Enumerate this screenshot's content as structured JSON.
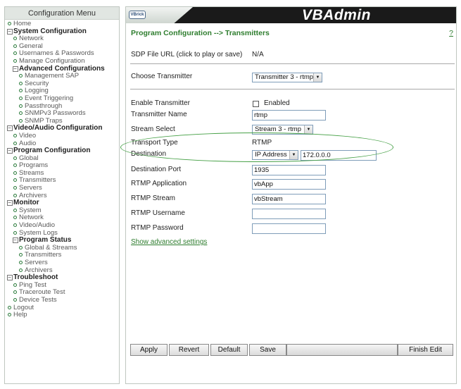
{
  "sidebar": {
    "title": "Configuration Menu",
    "items": [
      {
        "label": "Home",
        "level": 0,
        "marker": "dot"
      },
      {
        "label": "System Configuration",
        "level": 0,
        "marker": "box",
        "bold": true
      },
      {
        "label": "Network",
        "level": 1,
        "marker": "dot"
      },
      {
        "label": "General",
        "level": 1,
        "marker": "dot"
      },
      {
        "label": "Usernames & Passwords",
        "level": 1,
        "marker": "dot"
      },
      {
        "label": "Manage Configuration",
        "level": 1,
        "marker": "dot"
      },
      {
        "label": "Advanced Configurations",
        "level": 1,
        "marker": "box",
        "bold": true
      },
      {
        "label": "Management SAP",
        "level": 2,
        "marker": "dot"
      },
      {
        "label": "Security",
        "level": 2,
        "marker": "dot"
      },
      {
        "label": "Logging",
        "level": 2,
        "marker": "dot"
      },
      {
        "label": "Event Triggering",
        "level": 2,
        "marker": "dot"
      },
      {
        "label": "Passthrough",
        "level": 2,
        "marker": "dot"
      },
      {
        "label": "SNMPv3 Passwords",
        "level": 2,
        "marker": "dot"
      },
      {
        "label": "SNMP Traps",
        "level": 2,
        "marker": "dot"
      },
      {
        "label": "Video/Audio Configuration",
        "level": 0,
        "marker": "box",
        "bold": true
      },
      {
        "label": "Video",
        "level": 1,
        "marker": "dot"
      },
      {
        "label": "Audio",
        "level": 1,
        "marker": "dot"
      },
      {
        "label": "Program Configuration",
        "level": 0,
        "marker": "box",
        "bold": true
      },
      {
        "label": "Global",
        "level": 1,
        "marker": "dot"
      },
      {
        "label": "Programs",
        "level": 1,
        "marker": "dot"
      },
      {
        "label": "Streams",
        "level": 1,
        "marker": "dot"
      },
      {
        "label": "Transmitters",
        "level": 1,
        "marker": "dot"
      },
      {
        "label": "Servers",
        "level": 1,
        "marker": "dot"
      },
      {
        "label": "Archivers",
        "level": 1,
        "marker": "dot"
      },
      {
        "label": "Monitor",
        "level": 0,
        "marker": "box",
        "bold": true
      },
      {
        "label": "System",
        "level": 1,
        "marker": "dot"
      },
      {
        "label": "Network",
        "level": 1,
        "marker": "dot"
      },
      {
        "label": "Video/Audio",
        "level": 1,
        "marker": "dot"
      },
      {
        "label": "System Logs",
        "level": 1,
        "marker": "dot"
      },
      {
        "label": "Program Status",
        "level": 1,
        "marker": "box",
        "bold": true
      },
      {
        "label": "Global & Streams",
        "level": 2,
        "marker": "dot"
      },
      {
        "label": "Transmitters",
        "level": 2,
        "marker": "dot"
      },
      {
        "label": "Servers",
        "level": 2,
        "marker": "dot"
      },
      {
        "label": "Archivers",
        "level": 2,
        "marker": "dot"
      },
      {
        "label": "Troubleshoot",
        "level": 0,
        "marker": "box",
        "bold": true
      },
      {
        "label": "Ping Test",
        "level": 1,
        "marker": "dot"
      },
      {
        "label": "Traceroute Test",
        "level": 1,
        "marker": "dot"
      },
      {
        "label": "Device Tests",
        "level": 1,
        "marker": "dot"
      },
      {
        "label": "Logout",
        "level": 0,
        "marker": "dot"
      },
      {
        "label": "Help",
        "level": 0,
        "marker": "dot"
      }
    ]
  },
  "banner": {
    "logo_text": "VBrick",
    "app_title": "VBAdmin"
  },
  "header": {
    "title": "Program Configuration --> Transmitters",
    "help_link": "?"
  },
  "sdp": {
    "label": "SDP File URL (click to play or save)",
    "value": "N/A"
  },
  "choose": {
    "label": "Choose Transmitter",
    "selected": "Transmitter 3 - rtmp"
  },
  "form": {
    "enable_label": "Enable Transmitter",
    "enabled_checkbox_label": "Enabled",
    "enabled": false,
    "name_label": "Transmitter Name",
    "name_value": "rtmp",
    "stream_label": "Stream Select",
    "stream_selected": "Stream 3 - rtmp",
    "transport_label": "Transport Type",
    "transport_value": "RTMP",
    "destination_label": "Destination",
    "destination_type": "IP Address",
    "destination_value": "172.0.0.0",
    "port_label": "Destination Port",
    "port_value": "1935",
    "app_label": "RTMP Application",
    "app_value": "vbApp",
    "stream_name_label": "RTMP Stream",
    "stream_name_value": "vbStream",
    "username_label": "RTMP Username",
    "username_value": "",
    "password_label": "RTMP Password",
    "password_value": ""
  },
  "advanced_link": "Show advanced settings",
  "buttons": {
    "apply": "Apply",
    "revert": "Revert",
    "default": "Default",
    "save": "Save",
    "finish": "Finish Edit"
  },
  "colors": {
    "accent": "#2e7d2e",
    "annotation": "#46a046",
    "banner": "#1a1a1a"
  }
}
